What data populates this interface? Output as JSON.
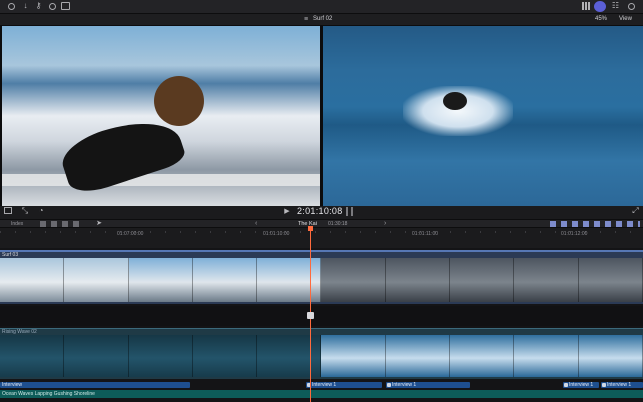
{
  "top_toolbar": {
    "left_icons": [
      "import-media-icon",
      "download-arrow-icon",
      "keywords-icon",
      "check-circle-icon",
      "tag-icon"
    ],
    "right_icons": [
      "grid-view-icon",
      "profile-avatar-icon",
      "inspector-icon",
      "circle-settings-icon"
    ]
  },
  "viewer_header": {
    "title": "Surf 02",
    "zoom": "45%",
    "view_label": "View"
  },
  "transport": {
    "timecode": "2:01:10:08"
  },
  "timeline_toolbar": {
    "index_label": "Index",
    "project_name": "The Kai",
    "duration": "01:30:18",
    "nav_back": "‹",
    "nav_forward": "›"
  },
  "ruler": {
    "ticks": [
      "01:07:00:00",
      "01:01:10:00",
      "01:01:11:00",
      "01:01:12:00"
    ]
  },
  "tracks": {
    "primary_name": "Surf 03",
    "secondary_name": "Rising Wave 02",
    "role_a": "Interview",
    "role_b": "Interview 1",
    "role_c": "Interview 1",
    "role_d": "Interview 1",
    "role_e": "Interview 1",
    "bottom_label": "Ocean Waves Lapping Gushing Shoreline"
  },
  "colors": {
    "playhead": "#ff6a3d",
    "role_blue": "#1e4f8f",
    "audio_teal": "#0d5c59"
  }
}
